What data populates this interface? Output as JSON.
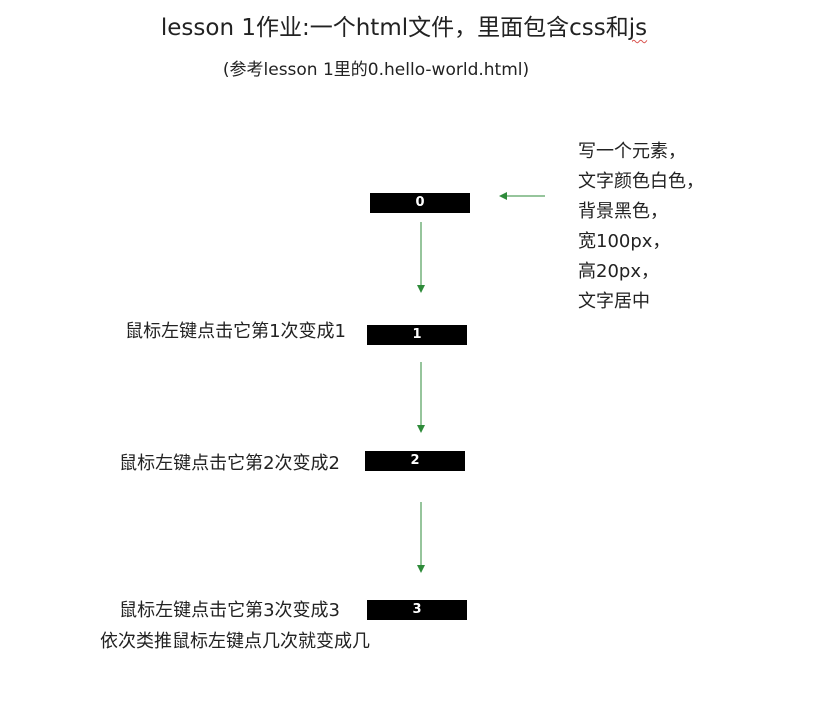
{
  "title": {
    "main": "lesson 1作业:一个html文件，里面包含css和",
    "suffix": "js"
  },
  "subtitle": "(参考lesson 1里的0.hello-world.html)",
  "spec_lines": [
    "写一个元素，",
    "文字颜色白色，",
    "背景黑色，",
    "宽100px，",
    "高20px，",
    "文字居中"
  ],
  "boxes": [
    "0",
    "1",
    "2",
    "3"
  ],
  "labels": {
    "step1": "鼠标左键点击它第1次变成1",
    "step2": "鼠标左键点击它第2次变成2",
    "step3": "鼠标左键点击它第3次变成3",
    "rule": "依次类推鼠标左键点几次就变成几"
  },
  "colors": {
    "arrow": "#2e8b3a",
    "box_bg": "#000000",
    "box_text": "#ffffff",
    "spellcheck": "#d9534f"
  }
}
